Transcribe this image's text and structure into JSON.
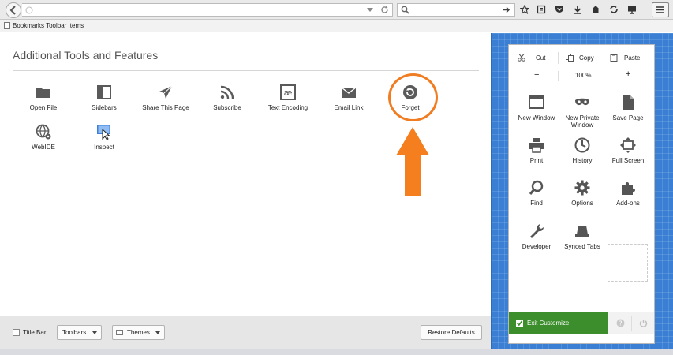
{
  "bookmarks_toolbar": {
    "label": "Bookmarks Toolbar Items"
  },
  "palette": {
    "title": "Additional Tools and Features",
    "items": [
      {
        "label": "Open File",
        "icon": "folder-icon"
      },
      {
        "label": "Sidebars",
        "icon": "sidebar-icon"
      },
      {
        "label": "Share This Page",
        "icon": "paper-plane-icon"
      },
      {
        "label": "Subscribe",
        "icon": "rss-icon"
      },
      {
        "label": "Text Encoding",
        "icon": "text-encoding-icon"
      },
      {
        "label": "Email Link",
        "icon": "envelope-icon"
      },
      {
        "label": "Forget",
        "icon": "forget-icon"
      },
      {
        "label": "WebIDE",
        "icon": "globe-gear-icon"
      },
      {
        "label": "Inspect",
        "icon": "inspect-icon"
      }
    ]
  },
  "bottom_bar": {
    "title_bar_label": "Title Bar",
    "toolbars_label": "Toolbars",
    "themes_label": "Themes",
    "restore_label": "Restore Defaults"
  },
  "menu_panel": {
    "edit": {
      "cut": "Cut",
      "copy": "Copy",
      "paste": "Paste"
    },
    "zoom": {
      "minus": "−",
      "level": "100%",
      "plus": "+"
    },
    "items": [
      {
        "label": "New Window"
      },
      {
        "label": "New Private Window"
      },
      {
        "label": "Save Page"
      },
      {
        "label": "Print"
      },
      {
        "label": "History"
      },
      {
        "label": "Full Screen"
      },
      {
        "label": "Find"
      },
      {
        "label": "Options"
      },
      {
        "label": "Add-ons"
      },
      {
        "label": "Developer"
      },
      {
        "label": "Synced Tabs"
      }
    ],
    "exit_label": "Exit Customize"
  },
  "colors": {
    "exit_green": "#3b8e2b",
    "panel_blue": "#3a7fd4",
    "highlight_orange": "#f07d22"
  }
}
